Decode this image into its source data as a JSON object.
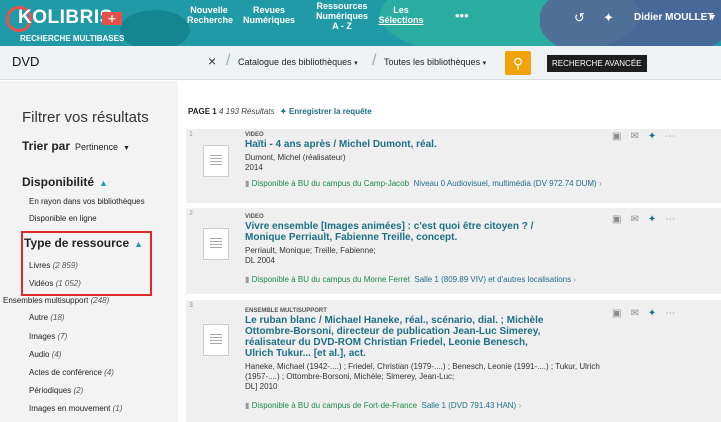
{
  "header": {
    "brand": "OLIBRIS",
    "brand_letter": "K",
    "brand_sub": "RECHERCHE MULTIBASES",
    "nav": [
      {
        "l1": "Nouvelle",
        "l2": "Recherche"
      },
      {
        "l1": "Revues",
        "l2": "Numériques"
      },
      {
        "l1": "Ressources",
        "l2": "Numériques",
        "l3": "A - Z"
      },
      {
        "l1": "Les",
        "l2": "Sélections"
      }
    ],
    "user": "Didier MOULLET"
  },
  "search": {
    "query": "DVD",
    "clear_icon": "×",
    "catalog_select": "Catalogue des bibliothèques",
    "library_select": "Toutes les bibliothèques",
    "advanced_label": "RECHERCHE AVANCÉE"
  },
  "sidebar": {
    "filter_title": "Filtrer vos résultats",
    "sort_label": "Trier par",
    "sort_value": "Pertinence",
    "availability_title": "Disponibilité",
    "availability_items": [
      {
        "label": "En rayon dans vos bibliothèques"
      },
      {
        "label": "Disponible en ligne"
      }
    ],
    "type_title": "Type de ressource",
    "type_items": [
      {
        "label": "Livres",
        "count": "(2 859)"
      },
      {
        "label": "Vidéos",
        "count": "(1 052)"
      },
      {
        "label": "Ensembles multisupport",
        "count": "(248)"
      },
      {
        "label": "Autre",
        "count": "(18)"
      },
      {
        "label": "Images",
        "count": "(7)"
      },
      {
        "label": "Audio",
        "count": "(4)"
      },
      {
        "label": "Actes de conférence",
        "count": "(4)"
      },
      {
        "label": "Périodiques",
        "count": "(2)"
      },
      {
        "label": "Images en mouvement",
        "count": "(1)"
      }
    ]
  },
  "results_header": {
    "page": "PAGE 1",
    "count": "4 193 Résultats",
    "save_label": "Enregistrer la requête"
  },
  "results": [
    {
      "index": "1",
      "kind": "VIDEO",
      "title_lines": [
        "Haïti - 4 ans après / Michel Dumont, réal."
      ],
      "meta_lines": [
        "Dumont, Michel (réalisateur)",
        "2014"
      ],
      "availability": "Disponible à BU du campus du Camp-Jacob",
      "location": "Niveau 0 Audiovisuel, multimédia (DV 972.74 DUM)"
    },
    {
      "index": "2",
      "kind": "VIDEO",
      "title_lines": [
        "Vivre ensemble [Images animées] : c'est quoi être citoyen ? /",
        "Monique Perriault, Fabienne Treille, concept."
      ],
      "meta_lines": [
        "Perriault, Monique; Treille, Fabienne;",
        "DL 2004"
      ],
      "availability": "Disponible à BU du campus du Morne Ferret",
      "location": "Salle 1 (809.89 VIV) et d'autres localisations"
    },
    {
      "index": "3",
      "kind": "ENSEMBLE MULTISUPPORT",
      "title_lines": [
        "Le ruban blanc / Michael Haneke, réal., scénario, dial. ; Michèle",
        "Ottombre-Borsoni, directeur de publication Jean-Luc Simerey,",
        "réalisateur du DVD-ROM Christian Friedel, Leonie Benesch,",
        "Ulrich Tukur... [et al.], act."
      ],
      "meta_lines": [
        "Haneke, Michael (1942-....) ; Friedel, Christian (1979-....) ; Benesch, Leonie (1991-....) ; Tukur, Ulrich",
        "(1957-....) ; Ottombre-Borsoni, Michèle; Simerey, Jean-Luc;",
        "DL] 2010"
      ],
      "availability": "Disponible à BU du campus de Fort-de-France",
      "location": "Salle 1 (DVD 791.43 HAN)"
    }
  ],
  "colors": {
    "accent": "#1d6f86",
    "header": "#1f9aa6",
    "search_button": "#f0a30a",
    "highlight_box": "#e02a2a",
    "available": "#1a8a4a"
  }
}
